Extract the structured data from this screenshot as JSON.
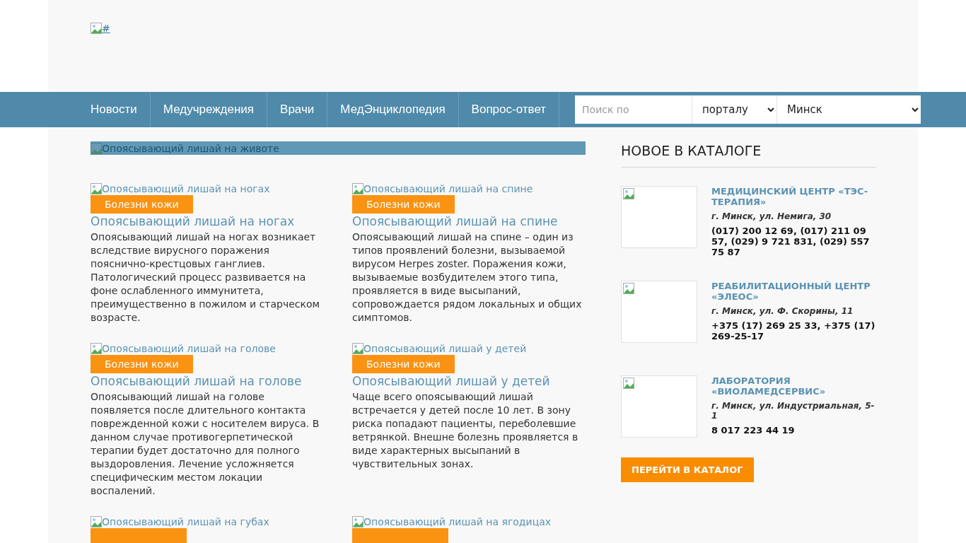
{
  "header": {
    "logo_alt": "#"
  },
  "nav": {
    "items": [
      {
        "label": "Новости"
      },
      {
        "label": "Медучреждения"
      },
      {
        "label": "Врачи"
      },
      {
        "label": "МедЭнциклопедия"
      },
      {
        "label": "Вопрос-ответ"
      }
    ],
    "search": {
      "placeholder": "Поиск по",
      "scope": "порталу",
      "city": "Минск"
    }
  },
  "banner": {
    "image_alt": "Опоясывающий лишай на животе"
  },
  "articles": [
    {
      "image_alt": "Опоясывающий лишай на ногах",
      "tag": "Болезни кожи",
      "title": "Опоясывающий лишай на ногах",
      "text": "Опоясывающий лишай на ногах возникает вследствие вирусного поражения пояснично-крестцовых ганглиев. Патологический процесс развивается на фоне ослабленного иммунитета, преимущественно в пожилом и старческом возрасте."
    },
    {
      "image_alt": "Опоясывающий лишай на спине",
      "tag": "Болезни кожи",
      "title": "Опоясывающий лишай на спине",
      "text": "Опоясывающий лишай на спине – один из типов проявлений болезни, вызываемой вирусом Herpes zoster. Поражения кожи, вызываемые возбудителем этого типа, проявляется в виде высыпаний, сопровождается рядом локальных и общих симптомов."
    },
    {
      "image_alt": "Опоясывающий лишай на голове",
      "tag": "Болезни кожи",
      "title": "Опоясывающий лишай на голове",
      "text": "Опоясывающий лишай на голове появляется после длительного контакта поврежденной кожи с носителем вируса. В данном случае противогерпетической терапии будет достаточно для полного выздоровления. Лечение усложняется специфическим местом локации воспалений."
    },
    {
      "image_alt": "Опоясывающий лишай у детей",
      "tag": "Болезни кожи",
      "title": "Опоясывающий лишай у детей",
      "text": "Чаще всего опоясывающий лишай встречается у детей после 10 лет. В зону риска попадают пациенты, переболевшие ветрянкой. Внешне болезнь проявляется в виде характерных высыпаний в чувствительных зонах."
    },
    {
      "image_alt": "Опоясывающий лишай на губах"
    },
    {
      "image_alt": "Опоясывающий лишай на ягодицах"
    }
  ],
  "catalog": {
    "heading": "НОВОЕ В КАТАЛОГЕ",
    "items": [
      {
        "name": "МЕДИЦИНСКИЙ ЦЕНТР «ТЭС-ТЕРАПИЯ»",
        "address": "г. Минск, ул. Немига, 30",
        "phones": "(017) 200 12 69, (017) 211 09 57, (029) 9 721 831, (029) 557 75 87"
      },
      {
        "name": "РЕАБИЛИТАЦИОННЫЙ ЦЕНТР «ЭЛЕОС»",
        "address": "г. Минск, ул. Ф. Скорины, 11",
        "phones": "+375 (17) 269 25 33, +375 (17) 269-25-17"
      },
      {
        "name": "ЛАБОРАТОРИЯ «ВИОЛАМЕДСЕРВИС»",
        "address": "г. Минск, ул. Индустриальная, 5-1",
        "phones": "8 017 223 44 19"
      }
    ],
    "button": "ПЕРЕЙТИ В КАТАЛОГ"
  }
}
